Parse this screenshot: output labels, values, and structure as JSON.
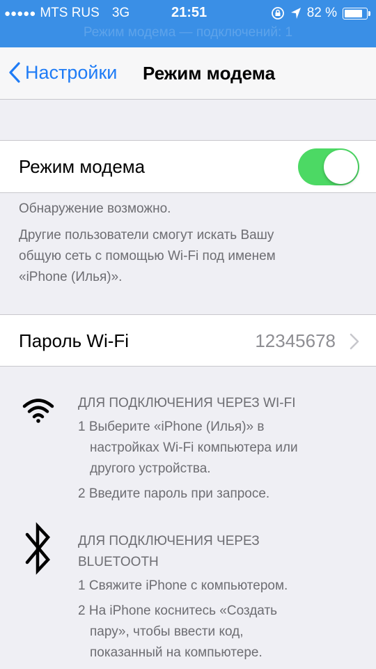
{
  "status_bar": {
    "signal_dots": "●●●●●",
    "carrier": "MTS RUS",
    "network": "3G",
    "time": "21:51",
    "battery_percent": "82 %",
    "battery_level": 0.82
  },
  "hotspot_banner": "Режим модема — подключений: 1",
  "nav": {
    "back_label": "Настройки",
    "title": "Режим модема"
  },
  "hotspot_toggle": {
    "label": "Режим модема",
    "on": true
  },
  "discovery_note": {
    "line1": "Обнаружение возможно.",
    "line2": "Другие пользователи смогут искать Вашу",
    "line3": "общую сеть с помощью Wi-Fi под именем",
    "line4": "«iPhone (Илья)»."
  },
  "wifi_password": {
    "label": "Пароль Wi-Fi",
    "value": "12345678"
  },
  "wifi_section": {
    "header": "ДЛЯ ПОДКЛЮЧЕНИЯ ЧЕРЕЗ WI-FI",
    "step1_line1": "1 Выберите «iPhone (Илья)» в",
    "step1_line2": "настройках Wi-Fi компьютера или",
    "step1_line3": "другого устройства.",
    "step2": "2 Введите пароль при запросе."
  },
  "bluetooth_section": {
    "header_line1": "ДЛЯ ПОДКЛЮЧЕНИЯ ЧЕРЕЗ",
    "header_line2": "BLUETOOTH",
    "step1": "1 Свяжите iPhone с компьютером.",
    "step2_line1": "2 На iPhone коснитесь «Создать",
    "step2_line2": "пару», чтобы ввести код,",
    "step2_line3": "показанный на компьютере."
  },
  "colors": {
    "status_bar": "#3a8fe6",
    "accent": "#1f7cf6",
    "toggle_on": "#4cd964",
    "background": "#efeff4"
  }
}
